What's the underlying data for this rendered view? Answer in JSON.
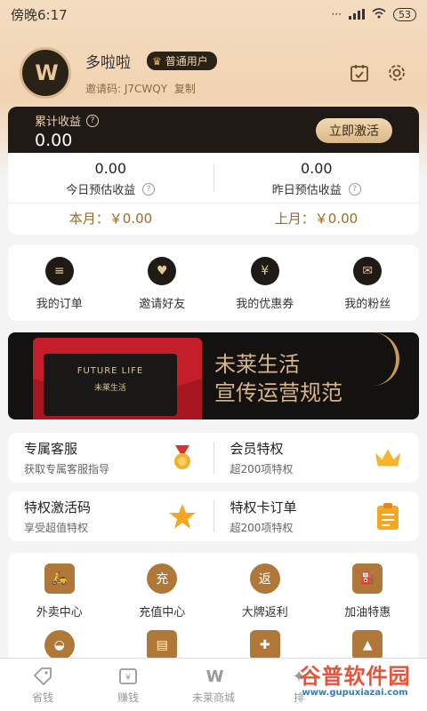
{
  "status": {
    "time": "傍晚6:17",
    "battery": "53"
  },
  "profile": {
    "name": "多啦啦",
    "level": "普通用户",
    "invite_label": "邀请码: J7CWQY",
    "copy": "复制",
    "avatar_text": "W"
  },
  "earnings": {
    "label": "累计收益",
    "value": "0.00",
    "activate": "立即激活",
    "today_value": "0.00",
    "today_label": "今日预估收益",
    "yesterday_value": "0.00",
    "yesterday_label": "昨日预估收益",
    "this_month": "本月：￥0.00",
    "last_month": "上月：￥0.00"
  },
  "quick": [
    {
      "label": "我的订单",
      "icon": "order-icon"
    },
    {
      "label": "邀请好友",
      "icon": "invite-icon"
    },
    {
      "label": "我的优惠券",
      "icon": "coupon-icon"
    },
    {
      "label": "我的粉丝",
      "icon": "fans-icon"
    }
  ],
  "banner": {
    "card_en": "FUTURE LIFE",
    "card_cn": "未莱生活",
    "line1": "未莱生活",
    "line2": "宣传运营规范"
  },
  "services": [
    {
      "title": "专属客服",
      "sub": "获取专属客服指导",
      "icon": "medal-icon"
    },
    {
      "title": "会员特权",
      "sub": "超200项特权",
      "icon": "crown-icon"
    },
    {
      "title": "特权激活码",
      "sub": "享受超值特权",
      "icon": "star-icon"
    },
    {
      "title": "特权卡订单",
      "sub": "超200项特权",
      "icon": "clipboard-icon"
    }
  ],
  "grid": [
    {
      "label": "外卖中心",
      "icon": "delivery-icon",
      "glyph": "🛵"
    },
    {
      "label": "充值中心",
      "icon": "recharge-icon",
      "glyph": "充"
    },
    {
      "label": "大牌返利",
      "icon": "rebate-icon",
      "glyph": "返"
    },
    {
      "label": "加油特惠",
      "icon": "fuel-icon",
      "glyph": "⛽"
    }
  ],
  "nav": [
    {
      "label": "省钱",
      "icon": "tag-icon"
    },
    {
      "label": "赚钱",
      "icon": "wallet-icon"
    },
    {
      "label": "未莱商城",
      "icon": "logo-icon"
    },
    {
      "label": "排",
      "icon": "rank-icon"
    }
  ],
  "watermark": {
    "line1": "谷普软件园",
    "line2": "www.gupuxiazai.com"
  },
  "colors": {
    "accent": "#9b6a27",
    "dark": "#1f1a15",
    "gold": "#e6c596"
  }
}
